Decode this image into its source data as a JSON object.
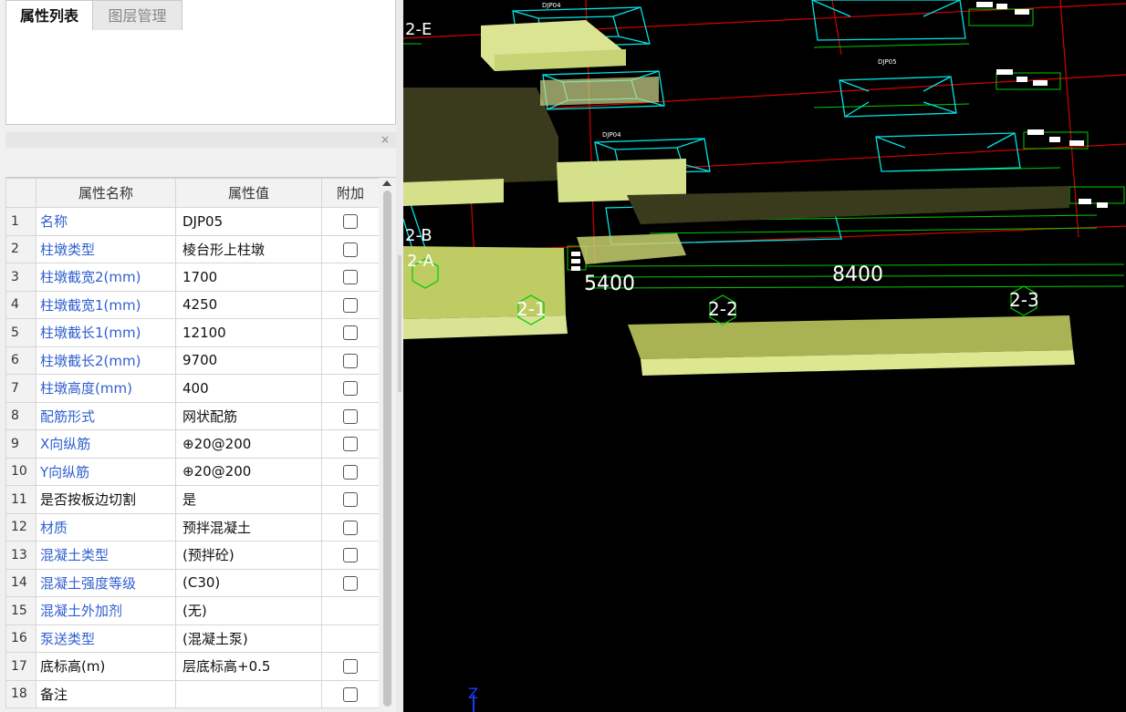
{
  "panel": {
    "tabs": [
      {
        "label": "属性列表",
        "active": true
      },
      {
        "label": "图层管理",
        "active": false
      }
    ],
    "close_icon": "×",
    "columns": [
      "属性名称",
      "属性值",
      "附加"
    ],
    "rows": [
      {
        "num": "1",
        "name": "名称",
        "value": "DJP05",
        "has_checkbox": true,
        "checked": false
      },
      {
        "num": "2",
        "name": "柱墩类型",
        "value": "棱台形上柱墩",
        "has_checkbox": true,
        "checked": false
      },
      {
        "num": "3",
        "name": "柱墩截宽2(mm)",
        "value": "1700",
        "has_checkbox": true,
        "checked": false
      },
      {
        "num": "4",
        "name": "柱墩截宽1(mm)",
        "value": "4250",
        "has_checkbox": true,
        "checked": false
      },
      {
        "num": "5",
        "name": "柱墩截长1(mm)",
        "value": "12100",
        "has_checkbox": true,
        "checked": false
      },
      {
        "num": "6",
        "name": "柱墩截长2(mm)",
        "value": "9700",
        "has_checkbox": true,
        "checked": false
      },
      {
        "num": "7",
        "name": "柱墩高度(mm)",
        "value": "400",
        "has_checkbox": true,
        "checked": false
      },
      {
        "num": "8",
        "name": "配筋形式",
        "value": "网状配筋",
        "has_checkbox": true,
        "checked": false
      },
      {
        "num": "9",
        "name": "X向纵筋",
        "value": "⊕20@200",
        "has_checkbox": true,
        "checked": false
      },
      {
        "num": "10",
        "name": "Y向纵筋",
        "value": "⊕20@200",
        "has_checkbox": true,
        "checked": false
      },
      {
        "num": "11",
        "name": "是否按板边切割",
        "value": "是",
        "has_checkbox": true,
        "checked": false
      },
      {
        "num": "12",
        "name": "材质",
        "value": "预拌混凝土",
        "has_checkbox": true,
        "checked": false
      },
      {
        "num": "13",
        "name": "混凝土类型",
        "value": "(预拌砼)",
        "has_checkbox": true,
        "checked": false
      },
      {
        "num": "14",
        "name": "混凝土强度等级",
        "value": "(C30)",
        "has_checkbox": true,
        "checked": false
      },
      {
        "num": "15",
        "name": "混凝土外加剂",
        "value": "(无)",
        "has_checkbox": false,
        "checked": false
      },
      {
        "num": "16",
        "name": "泵送类型",
        "value": "(混凝土泵)",
        "has_checkbox": false,
        "checked": false
      },
      {
        "num": "17",
        "name": "底标高(m)",
        "value": "层底标高+0.5",
        "has_checkbox": true,
        "checked": false
      },
      {
        "num": "18",
        "name": "备注",
        "value": "",
        "has_checkbox": true,
        "checked": false
      }
    ]
  },
  "viewport": {
    "dimensions": [
      "5400",
      "8400"
    ],
    "axis_labels": [
      "2-E",
      "2-B",
      "2-A",
      "2-1",
      "2-2",
      "2-3"
    ],
    "element_tags": [
      "DJP04",
      "DJP05"
    ],
    "axis_indicator": "Z",
    "colors": {
      "background": "#000000",
      "slab": "#d4e08a",
      "outline": "#00e5e5",
      "gridline": "#d40000",
      "dimension": "#00cc00",
      "text": "#ffffff"
    }
  }
}
